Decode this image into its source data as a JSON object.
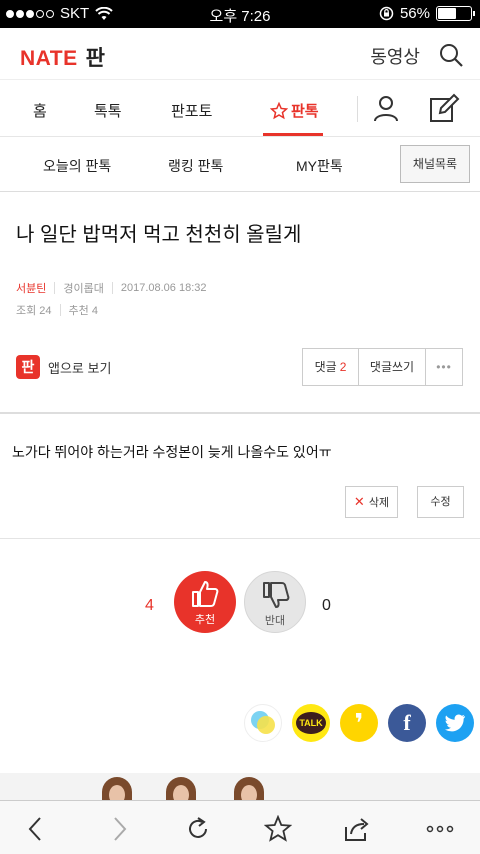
{
  "status_bar": {
    "carrier": "SKT",
    "time": "오후 7:26",
    "battery": "56%",
    "battery_level": 0.56
  },
  "header": {
    "logo": "NATE",
    "logo_sub": "판",
    "video_link": "동영상"
  },
  "main_nav": {
    "items": [
      {
        "label": "홈"
      },
      {
        "label": "톡톡"
      },
      {
        "label": "판포토"
      },
      {
        "label": "판톡"
      }
    ],
    "active": "판톡"
  },
  "sub_nav": {
    "items": [
      {
        "label": "오늘의 판톡"
      },
      {
        "label": "랭킹 판톡"
      },
      {
        "label": "MY판톡"
      }
    ],
    "channel_list": "채널목록"
  },
  "article": {
    "title": "나 일단 밥먹저 먹고 천천히 올릴게",
    "author": "서뷴틴",
    "channel": "경이롭대",
    "date": "2017.08.06 18:32",
    "views": "조회 24",
    "recommend": "추천 4",
    "app_view": "앱으로 보기",
    "app_icon": "판",
    "comments_label": "댓글",
    "comments_count": "2",
    "write_comment": "댓글쓰기",
    "more": "•••",
    "body": "노가다 뛰어야 하는거라 수정본이 늦게 나올수도 있어ㅠ",
    "delete": "삭제",
    "edit": "수정"
  },
  "vote": {
    "up_count": "4",
    "up_label": "추천",
    "down_label": "반대",
    "down_count": "0"
  },
  "share": {
    "kakaotalk_label": "TALK",
    "facebook_label": "f",
    "kakaostory_label": "❜"
  },
  "icons": {
    "search": "search-icon",
    "user": "user-icon",
    "write": "write-icon",
    "star": "star-icon",
    "back": "back-icon",
    "forward": "forward-icon",
    "reload": "reload-icon",
    "bookmark": "bookmark-star-icon",
    "share": "share-icon",
    "more": "more-icon"
  },
  "colors": {
    "brand": "#e8332a",
    "facebook": "#3b5998",
    "twitter": "#1da1f2",
    "kakao": "#ffe812"
  }
}
